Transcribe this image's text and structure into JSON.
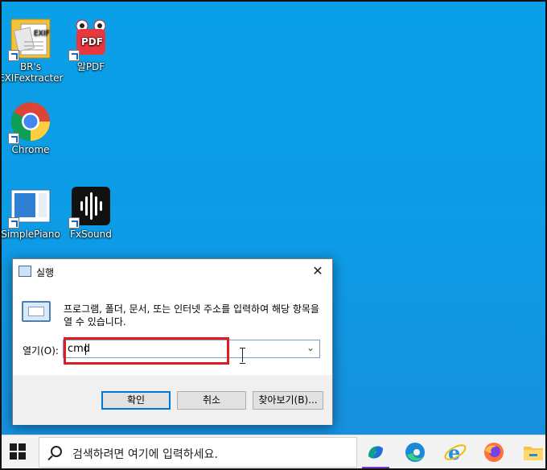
{
  "desktop": {
    "icons": [
      {
        "label_line1": "BR's",
        "label_line2": "EXIFextracter",
        "badge": "EXIF",
        "icon": "exif-app-icon"
      },
      {
        "label_line1": "알PDF",
        "label_line2": "",
        "badge": "PDF",
        "icon": "alpdf-icon"
      },
      {
        "label_line1": "Chrome",
        "label_line2": "",
        "icon": "chrome-icon"
      },
      {
        "label_line1": "SimplePiano",
        "label_line2": "",
        "icon": "simplepiano-icon"
      },
      {
        "label_line1": "FxSound",
        "label_line2": "",
        "icon": "fxsound-icon"
      }
    ]
  },
  "run_dialog": {
    "title": "실행",
    "close_glyph": "✕",
    "description": "프로그램, 폴더, 문서, 또는 인터넷 주소를 입력하여 해당 항목을 열 수 있습니다.",
    "open_label": "열기(O):",
    "input_value": "cmd",
    "dropdown_glyph": "⌄",
    "ok_label": "확인",
    "cancel_label": "취소",
    "browse_label": "찾아보기(B)..."
  },
  "taskbar": {
    "search_placeholder": "검색하려면 여기에 입력하세요.",
    "pinned": [
      "copilot-icon",
      "edge-icon",
      "internet-explorer-icon",
      "firefox-icon",
      "file-explorer-icon"
    ]
  },
  "colors": {
    "desktop": "#0aa0e8",
    "highlight": "#e01b24",
    "accent": "#0078d7"
  }
}
